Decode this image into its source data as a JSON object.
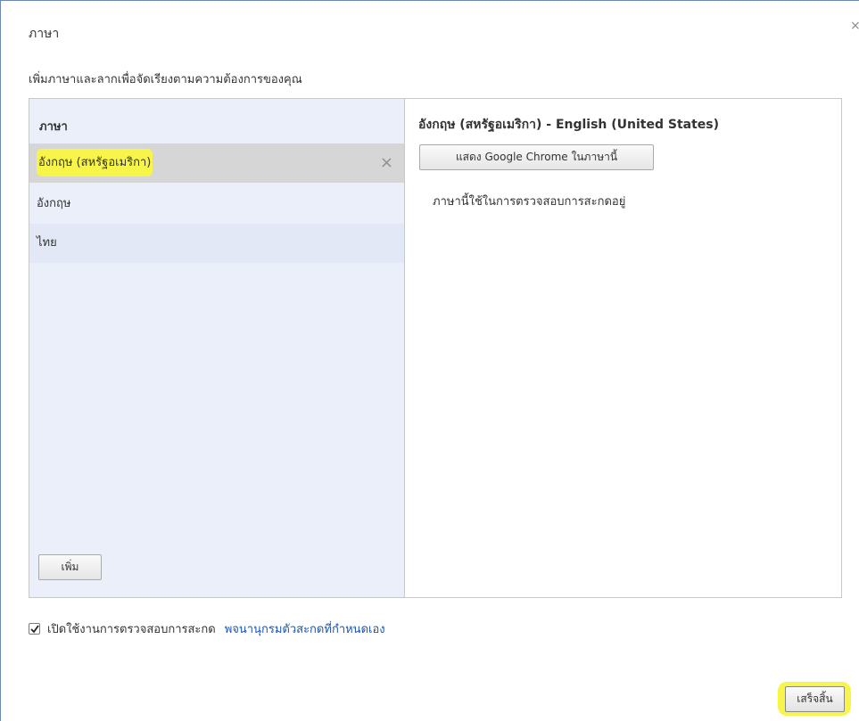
{
  "dialog": {
    "title": "ภาษา",
    "subtitle": "เพิ่มภาษาและลากเพื่อจัดเรียงตามความต้องการของคุณ",
    "close_glyph": "×"
  },
  "language_list": {
    "header": "ภาษา",
    "items": [
      {
        "label": "อังกฤษ (สหรัฐอเมริกา)",
        "selected": true
      },
      {
        "label": "อังกฤษ",
        "selected": false
      },
      {
        "label": "ไทย",
        "selected": false
      }
    ],
    "remove_glyph": "×",
    "add_label": "เพิ่ม"
  },
  "details": {
    "title": "อังกฤษ (สหรัฐอเมริกา) - English (United States)",
    "display_button_label": "แสดง Google Chrome ในภาษานี้",
    "spellcheck_note": "ภาษานี้ใช้ในการตรวจสอบการสะกดอยู่"
  },
  "footer": {
    "spellcheck_checked": true,
    "spellcheck_label": "เปิดใช้งานการตรวจสอบการสะกด",
    "custom_dictionary_link": "พจนานุกรมตัวสะกดที่กำหนดเอง",
    "done_label": "เสร็จสิ้น"
  },
  "colors": {
    "highlight": "#f7f54a",
    "list_background": "#ebeff9",
    "link": "#1a55b8"
  }
}
